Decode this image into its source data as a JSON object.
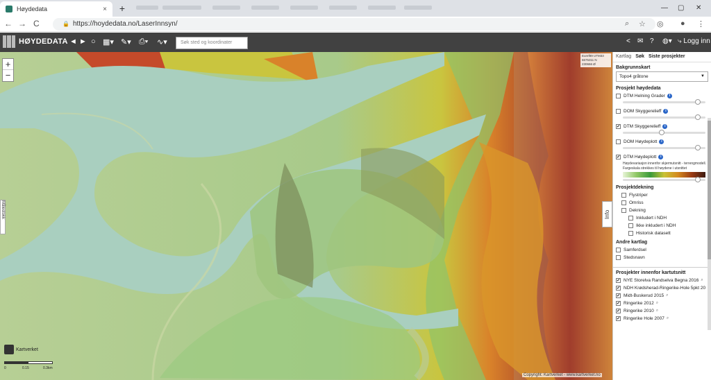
{
  "browser": {
    "tab_title": "Høydedata",
    "tab_close": "×",
    "new_tab": "+",
    "url": "https://hoydedata.no/LaserInnsyn/",
    "back": "←",
    "forward": "→",
    "reload": "C",
    "window_controls": [
      "—",
      "▢",
      "✕"
    ]
  },
  "app": {
    "logo_text": "HØYDEDATA",
    "search_placeholder": "Søk sted og koordinater",
    "login_label": "Logg inn",
    "toolbar_icons": [
      "arrow-left-icon",
      "arrow-right-icon",
      "circle-icon",
      "map-icon",
      "pencil-icon",
      "print-icon",
      "profile-icon"
    ]
  },
  "map": {
    "coord_system": "Euref89 UTM33",
    "coord_north": "6675311 N",
    "coord_east": "230666 Ø",
    "left_tab": "Målestokk",
    "info_tab": "Info",
    "attribution": "Kartverket",
    "scale_labels": [
      "0",
      "0.15",
      "0.3km"
    ],
    "copyright": "Copyright: Kartverket - www.kartverket.no"
  },
  "panel": {
    "tabs": [
      "Kartlag",
      "Søk",
      "Siste prosjekter"
    ],
    "basemap_heading": "Bakgrunnskart",
    "basemap_value": "Topo4 gråtone",
    "project_heading": "Prosjekt høydedata",
    "project_layers": [
      {
        "label": "DTM Helning Grader",
        "checked": false
      },
      {
        "label": "DOM Skyggerelieff",
        "checked": false
      },
      {
        "label": "DTM Skyggerelieff",
        "checked": true
      },
      {
        "label": "DOM Høydeplott",
        "checked": false
      },
      {
        "label": "DTM Høydeplott",
        "checked": true
      }
    ],
    "dtm_hoydeplott_desc": "Høydevariasjon innenfor skjermutsnitt - terrengmodell. Fargeskala strekkes til høydene i utsnittet",
    "coverage_heading": "Prosjektdekning",
    "coverage_layers": [
      "Flystriper",
      "Omriss",
      "Dekning"
    ],
    "coverage_sub": [
      "Inkludert i NDH",
      "Ikke inkludert i NDH",
      "Historisk datasett"
    ],
    "other_heading": "Andre kartlag",
    "other_layers": [
      "Samferdsel",
      "Stedsnavn"
    ],
    "projects_heading": "Prosjekter innenfor kartutsnitt",
    "projects": [
      "NYE Storelva Randselva Begna 2016",
      "NDH Krødsherad-Ringerike-Hole 5pkt 20",
      "Midt-Buskerud 2015",
      "Ringerike 2012",
      "Ringerike 2010",
      "Ringerike Hole 2007"
    ]
  }
}
